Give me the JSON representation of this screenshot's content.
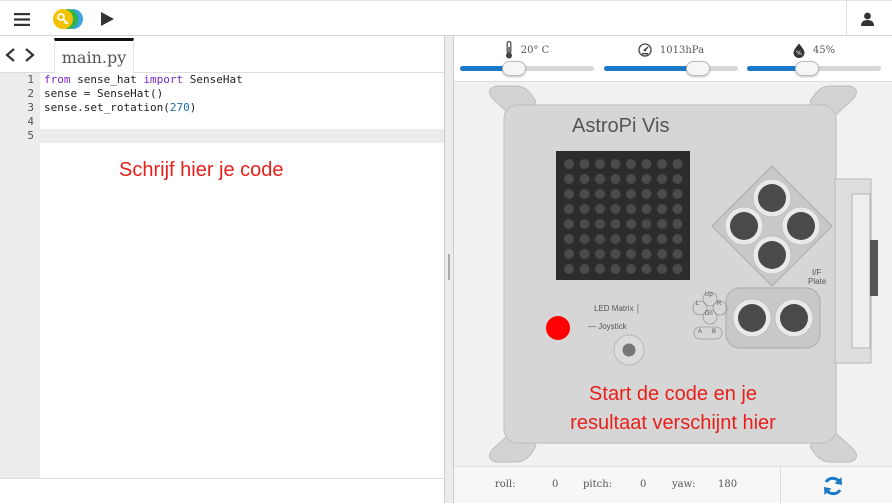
{
  "toolbar": {
    "menu_icon": "hamburger-menu-icon",
    "logo_icon": "key-logo-icon",
    "run_icon": "play-icon",
    "user_icon": "user-icon"
  },
  "editor": {
    "back_icon": "chevron-left-icon",
    "forward_icon": "chevron-right-icon",
    "tab_label": "main.py",
    "lines": [
      {
        "num": "1",
        "parts": [
          {
            "t": "from",
            "c": "kw"
          },
          {
            "t": " sense_hat ",
            "c": ""
          },
          {
            "t": "import",
            "c": "kw"
          },
          {
            "t": " SenseHat",
            "c": ""
          }
        ]
      },
      {
        "num": "2",
        "parts": [
          {
            "t": "sense = SenseHat()",
            "c": ""
          }
        ]
      },
      {
        "num": "3",
        "parts": [
          {
            "t": "sense.set_rotation(",
            "c": ""
          },
          {
            "t": "270",
            "c": "num"
          },
          {
            "t": ")",
            "c": ""
          }
        ]
      },
      {
        "num": "4",
        "parts": []
      },
      {
        "num": "5",
        "parts": []
      }
    ],
    "active_line": 5,
    "hint": "Schrijf hier je code"
  },
  "emulator": {
    "sensors": [
      {
        "icon": "thermometer-icon",
        "value": "20° C",
        "fraction": 0.4
      },
      {
        "icon": "gauge-icon",
        "value": "1013hPa",
        "fraction": 0.7
      },
      {
        "icon": "humidity-icon",
        "value": "45%",
        "fraction": 0.45
      }
    ],
    "board": {
      "title": "AstroPi Vis",
      "led_matrix_label": "LED Matrix",
      "joystick_label": "Joystick",
      "io_label": "I/F",
      "plate_label": "Plate",
      "buttons": {
        "up": "Up",
        "down": "Dn",
        "left": "L",
        "right": "R",
        "a": "A",
        "b": "B"
      },
      "status_led_color": "#ff0000"
    },
    "hint_line1": "Start de code en je",
    "hint_line2": "resultaat verschijnt hier",
    "readout": {
      "roll_label": "roll:",
      "roll_value": "0",
      "pitch_label": "pitch:",
      "pitch_value": "0",
      "yaw_label": "yaw:",
      "yaw_value": "180"
    },
    "refresh_icon": "refresh-icon"
  },
  "colors": {
    "accent_blue": "#1a79c9",
    "hint_red": "#e8201c",
    "keyword_purple": "#7a2bc0",
    "number_blue": "#1a6ea8"
  }
}
